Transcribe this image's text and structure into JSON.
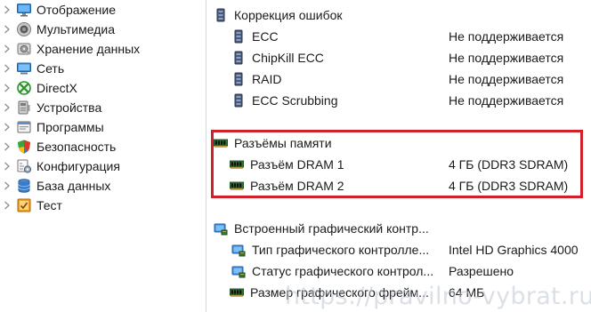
{
  "sidebar": {
    "items": [
      {
        "label": "Отображение",
        "icon": "monitor-icon"
      },
      {
        "label": "Мультимедиа",
        "icon": "speaker-icon"
      },
      {
        "label": "Хранение данных",
        "icon": "storage-icon"
      },
      {
        "label": "Сеть",
        "icon": "network-icon"
      },
      {
        "label": "DirectX",
        "icon": "xbox-icon"
      },
      {
        "label": "Устройства",
        "icon": "device-icon"
      },
      {
        "label": "Программы",
        "icon": "programs-icon"
      },
      {
        "label": "Безопасность",
        "icon": "shield-icon"
      },
      {
        "label": "Конфигурация",
        "icon": "config-icon"
      },
      {
        "label": "База данных",
        "icon": "database-icon"
      },
      {
        "label": "Тест",
        "icon": "test-icon"
      }
    ]
  },
  "details": {
    "ecc": {
      "header": "Коррекция ошибок",
      "rows": [
        {
          "name": "ECC",
          "value": "Не поддерживается"
        },
        {
          "name": "ChipKill ECC",
          "value": "Не поддерживается"
        },
        {
          "name": "RAID",
          "value": "Не поддерживается"
        },
        {
          "name": "ECC Scrubbing",
          "value": "Не поддерживается"
        }
      ]
    },
    "slots": {
      "header": "Разъёмы памяти",
      "rows": [
        {
          "name": "Разъём DRAM 1",
          "value": "4 ГБ  (DDR3 SDRAM)"
        },
        {
          "name": "Разъём DRAM 2",
          "value": "4 ГБ  (DDR3 SDRAM)"
        }
      ]
    },
    "graphics": {
      "header": "Встроенный графический контр...",
      "rows": [
        {
          "name": "Тип графического контроллe...",
          "value": "Intel HD Graphics 4000"
        },
        {
          "name": "Статус графического контрол...",
          "value": "Разрешено"
        },
        {
          "name": "Размер графического фрейм...",
          "value": "64 МБ"
        }
      ]
    }
  },
  "highlight_color": "#d0202a",
  "watermark": "https://pravilno-vybrat.ru"
}
